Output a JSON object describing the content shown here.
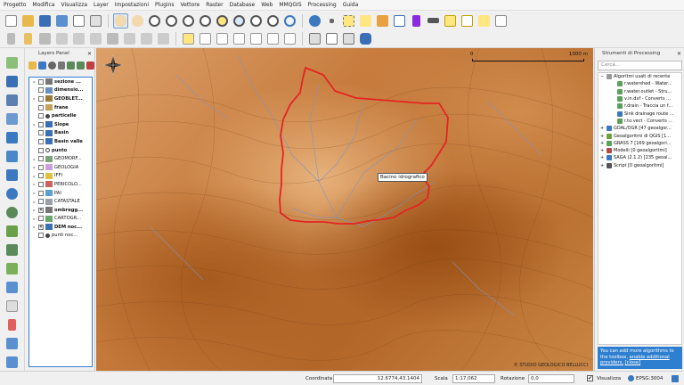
{
  "menu": [
    "Progetto",
    "Modifica",
    "Visualizza",
    "Layer",
    "Impostazioni",
    "Plugins",
    "Vettore",
    "Raster",
    "Database",
    "Web",
    "MMQGIS",
    "Processing",
    "Guida"
  ],
  "layers_panel": {
    "title": "Layers Panel",
    "layers": [
      {
        "name": "sezione ...",
        "checked": false,
        "bold": true,
        "expand": true,
        "icon": "line-layer-icon",
        "color": "#777777"
      },
      {
        "name": "dimensio...",
        "checked": false,
        "bold": true,
        "expand": false,
        "icon": "table-layer-icon",
        "color": "#6b8fc0"
      },
      {
        "name": "GEOBLET...",
        "checked": false,
        "bold": true,
        "expand": true,
        "icon": "polygon-layer-icon",
        "color": "#9c7a3c"
      },
      {
        "name": "frane",
        "checked": false,
        "bold": true,
        "expand": false,
        "icon": "polygon-layer-icon",
        "color": "#c4a25b"
      },
      {
        "name": "particelle",
        "checked": false,
        "bold": true,
        "expand": false,
        "icon": "point-layer-icon",
        "color": "#444444"
      },
      {
        "name": "Slope",
        "checked": false,
        "bold": true,
        "expand": true,
        "icon": "raster-layer-icon",
        "color": "#3b6fb5"
      },
      {
        "name": "Basin",
        "checked": false,
        "bold": true,
        "expand": false,
        "icon": "raster-layer-icon",
        "color": "#3b6fb5"
      },
      {
        "name": "Basin valle",
        "checked": false,
        "bold": true,
        "expand": false,
        "icon": "raster-layer-icon",
        "color": "#3b6fb5"
      },
      {
        "name": "punto",
        "checked": false,
        "bold": true,
        "expand": false,
        "icon": "point-layer-icon",
        "color": "#ffffff"
      },
      {
        "name": "GEOMORF...",
        "checked": false,
        "bold": false,
        "expand": true,
        "icon": "polygon-layer-icon",
        "color": "#7aa37a"
      },
      {
        "name": "GEOLOGIA",
        "checked": false,
        "bold": false,
        "expand": true,
        "icon": "polygon-layer-icon",
        "color": "#c9a0dc"
      },
      {
        "name": "IFFI",
        "checked": false,
        "bold": false,
        "expand": true,
        "icon": "polygon-layer-icon",
        "color": "#e0c040"
      },
      {
        "name": "PERICOLO...",
        "checked": false,
        "bold": false,
        "expand": true,
        "icon": "polygon-layer-icon",
        "color": "#d06060"
      },
      {
        "name": "PAI",
        "checked": false,
        "bold": false,
        "expand": true,
        "icon": "polygon-layer-icon",
        "color": "#5a9fd4"
      },
      {
        "name": "CATASTALE",
        "checked": false,
        "bold": false,
        "expand": true,
        "icon": "polygon-layer-icon",
        "color": "#9aa0a6"
      },
      {
        "name": "ombregg...",
        "checked": true,
        "bold": true,
        "expand": true,
        "icon": "raster-layer-icon",
        "color": "#777777"
      },
      {
        "name": "CARTOGR...",
        "checked": false,
        "bold": false,
        "expand": true,
        "icon": "polygon-layer-icon",
        "color": "#6aa86a"
      },
      {
        "name": "DEM noc...",
        "checked": true,
        "bold": true,
        "expand": true,
        "icon": "raster-layer-icon",
        "color": "#3b6fb5"
      },
      {
        "name": "punti noc...",
        "checked": false,
        "bold": false,
        "expand": false,
        "icon": "point-layer-icon",
        "color": "#444444"
      }
    ]
  },
  "map": {
    "label": "Bacino idrografico",
    "scale_left": "0",
    "scale_right": "1000",
    "scale_unit": "m",
    "credit": "© STUDIO GEOLOGICO BELLUCCI"
  },
  "processing": {
    "title": "Strumenti di Processing",
    "search_placeholder": "Cerca...",
    "items": [
      {
        "label": "Algoritmi usati di recente",
        "indent": 0,
        "expand": "−",
        "icon": "clock-icon",
        "color": "#9a9a9a"
      },
      {
        "label": "r.watershed - Water...",
        "indent": 2,
        "expand": "",
        "icon": "grass-tool-icon",
        "color": "#5aa05a"
      },
      {
        "label": "r.water.outlet - Stru...",
        "indent": 2,
        "expand": "",
        "icon": "grass-tool-icon",
        "color": "#5aa05a"
      },
      {
        "label": "v.in.dxf - Converts ...",
        "indent": 2,
        "expand": "",
        "icon": "grass-tool-icon",
        "color": "#5aa05a"
      },
      {
        "label": "r.drain - Traccia un f...",
        "indent": 2,
        "expand": "",
        "icon": "grass-tool-icon",
        "color": "#5aa05a"
      },
      {
        "label": "Sink drainage route ...",
        "indent": 2,
        "expand": "",
        "icon": "saga-tool-icon",
        "color": "#3a78c0"
      },
      {
        "label": "r.to.vect - Converts ...",
        "indent": 2,
        "expand": "",
        "icon": "grass-tool-icon",
        "color": "#5aa05a"
      },
      {
        "label": "GDAL/OGR [47 geoalgor...",
        "indent": 0,
        "expand": "+",
        "icon": "gdal-icon",
        "color": "#3a78c0"
      },
      {
        "label": "Geoalgoritmi di QGIS [1...",
        "indent": 0,
        "expand": "+",
        "icon": "qgis-icon",
        "color": "#6ba23a"
      },
      {
        "label": "GRASS 7 [169 geoalgori...",
        "indent": 0,
        "expand": "+",
        "icon": "grass-icon",
        "color": "#5aa05a"
      },
      {
        "label": "Modelli [0 geoalgoritmi]",
        "indent": 0,
        "expand": "+",
        "icon": "models-icon",
        "color": "#b04a4a"
      },
      {
        "label": "SAGA (2.1.2) [235 geoal...",
        "indent": 0,
        "expand": "+",
        "icon": "saga-icon",
        "color": "#3a78c0"
      },
      {
        "label": "Script [0 geoalgoritmi]",
        "indent": 0,
        "expand": "+",
        "icon": "script-icon",
        "color": "#555555"
      }
    ],
    "notice_text": "You can add more algorithms to the toolbox,",
    "notice_link1": "enable additional providers.",
    "notice_link2": "[close]"
  },
  "status": {
    "coord_label": "Coordinata",
    "coord_value": "12.6774,43.1404",
    "scale_label": "Scala",
    "scale_value": "1:17,062",
    "rotation_label": "Rotazione",
    "rotation_value": "0,0",
    "render_label": "Visualizza",
    "crs_label": "EPSG:3004"
  }
}
